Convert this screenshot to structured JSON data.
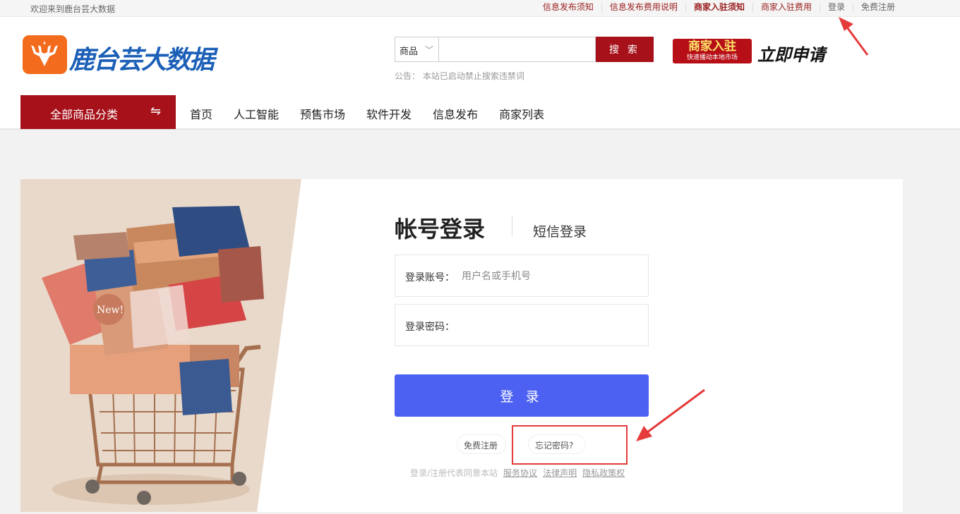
{
  "topbar": {
    "welcome": "欢迎来到鹿台芸大数据",
    "links": {
      "info_notice": "信息发布须知",
      "info_fee": "信息发布费用说明",
      "merchant_notice": "商家入驻须知",
      "merchant_fee": "商家入驻费用",
      "login": "登录",
      "register": "免费注册"
    }
  },
  "header": {
    "logo_text": "鹿台芸大数据",
    "search": {
      "category": "商品",
      "placeholder": "",
      "button": "搜 索"
    },
    "notice": "公告：   本站已启动禁止搜索违禁词",
    "merchant_banner": {
      "title": "商家入驻",
      "subtitle": "快速播动本地市场"
    },
    "apply_now": "立即申请"
  },
  "nav": {
    "category_button": "全部商品分类",
    "items": [
      "首页",
      "人工智能",
      "预售市场",
      "软件开发",
      "信息发布",
      "商家列表"
    ]
  },
  "login": {
    "tab_account": "帐号登录",
    "tab_sms": "短信登录",
    "account_label": "登录账号：",
    "account_placeholder": "用户名或手机号",
    "password_label": "登录密码：",
    "login_button": "登 录",
    "register_link": "免费注册",
    "forgot_link": "忘记密码?",
    "agreement": {
      "prefix": "登录/注册代表同意本站",
      "service": "服务协议",
      "legal": "法律声明",
      "privacy": "隐私政策权"
    }
  },
  "colors": {
    "brand_red": "#a6111a",
    "login_blue": "#4c61f2",
    "annotation_red": "#e53b3b",
    "logo_blue": "#1b5fb7",
    "logo_orange": "#f36b1c"
  }
}
